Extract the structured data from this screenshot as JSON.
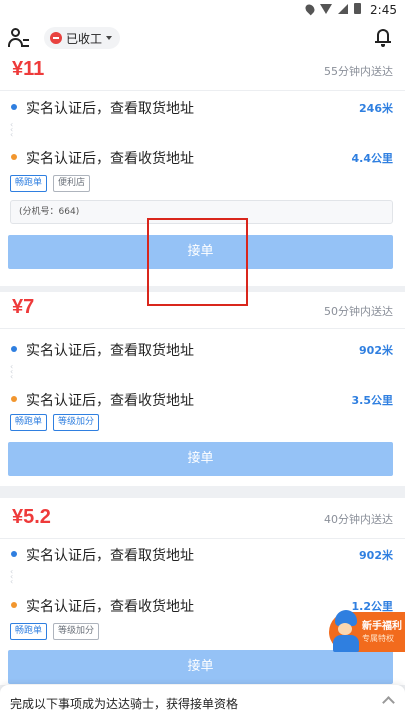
{
  "status_bar": {
    "time": "2:45"
  },
  "header": {
    "status_label": "已收工"
  },
  "orders": [
    {
      "price": "¥11",
      "eta": "55分钟内送达",
      "pickup": {
        "text": "实名认证后，查看取货地址",
        "distance": "246米"
      },
      "dropoff": {
        "text": "实名认证后，查看收货地址",
        "distance": "4.4公里"
      },
      "tags": [
        "畅跑单",
        "便利店"
      ],
      "note": "(分机号：664)",
      "accept_label": "接单"
    },
    {
      "price": "¥7",
      "eta": "50分钟内送达",
      "pickup": {
        "text": "实名认证后，查看取货地址",
        "distance": "902米"
      },
      "dropoff": {
        "text": "实名认证后，查看收货地址",
        "distance": "3.5公里"
      },
      "tags": [
        "畅跑单",
        "等级加分"
      ],
      "accept_label": "接单"
    },
    {
      "price": "¥5.2",
      "eta": "40分钟内送达",
      "pickup": {
        "text": "实名认证后，查看取货地址",
        "distance": "902米"
      },
      "dropoff": {
        "text": "实名认证后，查看收货地址",
        "distance": "1.2公里"
      },
      "tags": [
        "畅跑单",
        "等级加分"
      ],
      "accept_label": "接单"
    }
  ],
  "promo": {
    "title": "新手福利",
    "subtitle": "专属特权"
  },
  "bottom_bar": {
    "text": "完成以下事项成为达达骑士，获得接单资格"
  },
  "colors": {
    "price": "#ee3a3a",
    "accent": "#2f7fe0",
    "accept_button": "#95c2f6",
    "promo": "#f26b1d"
  }
}
